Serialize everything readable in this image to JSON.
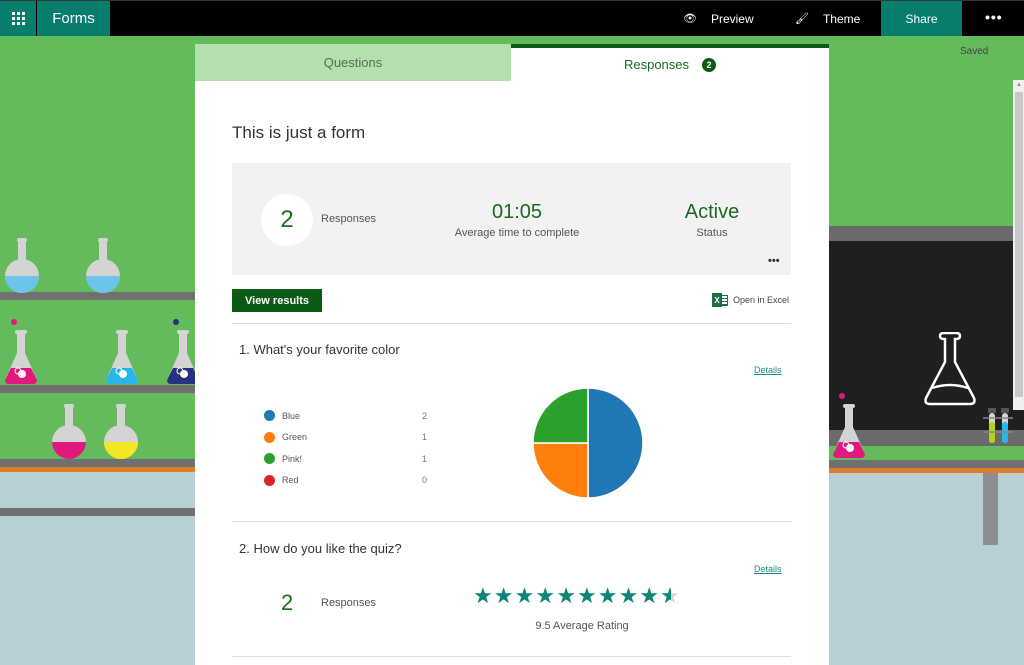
{
  "topbar": {
    "app_name": "Forms",
    "preview_label": "Preview",
    "theme_label": "Theme",
    "share_label": "Share",
    "more_label": "•••",
    "icons": {
      "waffle": "app-launcher-icon",
      "preview": "eye-icon",
      "theme": "paint-brush-icon"
    }
  },
  "save_status": "Saved",
  "tabs": [
    {
      "label": "Questions",
      "active": false
    },
    {
      "label": "Responses",
      "active": true,
      "badge": "2"
    }
  ],
  "form": {
    "title": "This is just a form"
  },
  "summary": {
    "responses_count": "2",
    "responses_label": "Responses",
    "avg_time": "01:05",
    "avg_time_label": "Average time to complete",
    "status_value": "Active",
    "status_label": "Status",
    "more_label": "•••"
  },
  "actions": {
    "view_results": "View results",
    "open_in_excel": "Open in Excel"
  },
  "questions": [
    {
      "title": "1.  What's your favorite color",
      "details_label": "Details",
      "type": "choice"
    },
    {
      "title": "2.  How do you like the quiz?",
      "details_label": "Details",
      "type": "rating",
      "responses_count": "2",
      "responses_label": "Responses",
      "rating_value": 9.5,
      "rating_max": 10,
      "rating_label": "9.5 Average Rating"
    }
  ],
  "chart_data": {
    "type": "pie",
    "title": "1.  What's your favorite color",
    "categories": [
      "Blue",
      "Green",
      "Pink!",
      "Red"
    ],
    "values": [
      2,
      1,
      1,
      0
    ],
    "colors": [
      "#1f77b4",
      "#ff7f0e",
      "#2ca02c",
      "#d62728"
    ],
    "legend": "left"
  },
  "colors": {
    "brand_teal": "#077d6b",
    "dark_green": "#0b5b14",
    "accent_green": "#1a6b1f",
    "star_teal": "#0d8577",
    "background_green": "#63bb5b"
  }
}
